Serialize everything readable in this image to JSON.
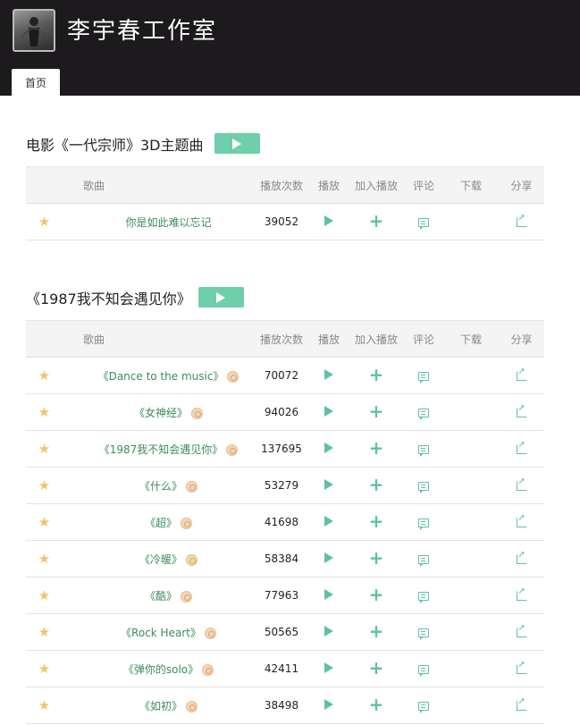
{
  "site": {
    "title": "李宇春工作室"
  },
  "nav": {
    "tabs": [
      {
        "label": "首页",
        "active": true
      }
    ]
  },
  "icons": {
    "avatar": "avatar-photo",
    "star": "star-icon",
    "play": "play-icon",
    "add": "plus-icon",
    "comment": "comment-icon",
    "share": "share-icon",
    "ringtone": "ringtone-icon"
  },
  "colors": {
    "header_bg": "#1c1a1c",
    "accent": "#6fcfaa",
    "song_link": "#3e8b5e",
    "star": "#f1c36a"
  },
  "columns": {
    "song": "歌曲",
    "count": "播放次数",
    "play": "播放",
    "add": "加入播放",
    "comment": "评论",
    "download": "下载",
    "share": "分享"
  },
  "sections": [
    {
      "title": "电影《一代宗师》3D主题曲",
      "songs": [
        {
          "name": "你是如此难以忘记",
          "count": "39052",
          "ringtone": false
        }
      ]
    },
    {
      "title": "《1987我不知会遇见你》",
      "songs": [
        {
          "name": "《Dance to the music》",
          "count": "70072",
          "ringtone": true
        },
        {
          "name": "《女神经》",
          "count": "94026",
          "ringtone": true
        },
        {
          "name": "《1987我不知会遇见你》",
          "count": "137695",
          "ringtone": true
        },
        {
          "name": "《什么》",
          "count": "53279",
          "ringtone": true
        },
        {
          "name": "《超》",
          "count": "41698",
          "ringtone": true
        },
        {
          "name": "《冷暖》",
          "count": "58384",
          "ringtone": true
        },
        {
          "name": "《酷》",
          "count": "77963",
          "ringtone": true
        },
        {
          "name": "《Rock Heart》",
          "count": "50565",
          "ringtone": true
        },
        {
          "name": "《弹你的solo》",
          "count": "42411",
          "ringtone": true
        },
        {
          "name": "《如初》",
          "count": "38498",
          "ringtone": true
        }
      ]
    }
  ]
}
